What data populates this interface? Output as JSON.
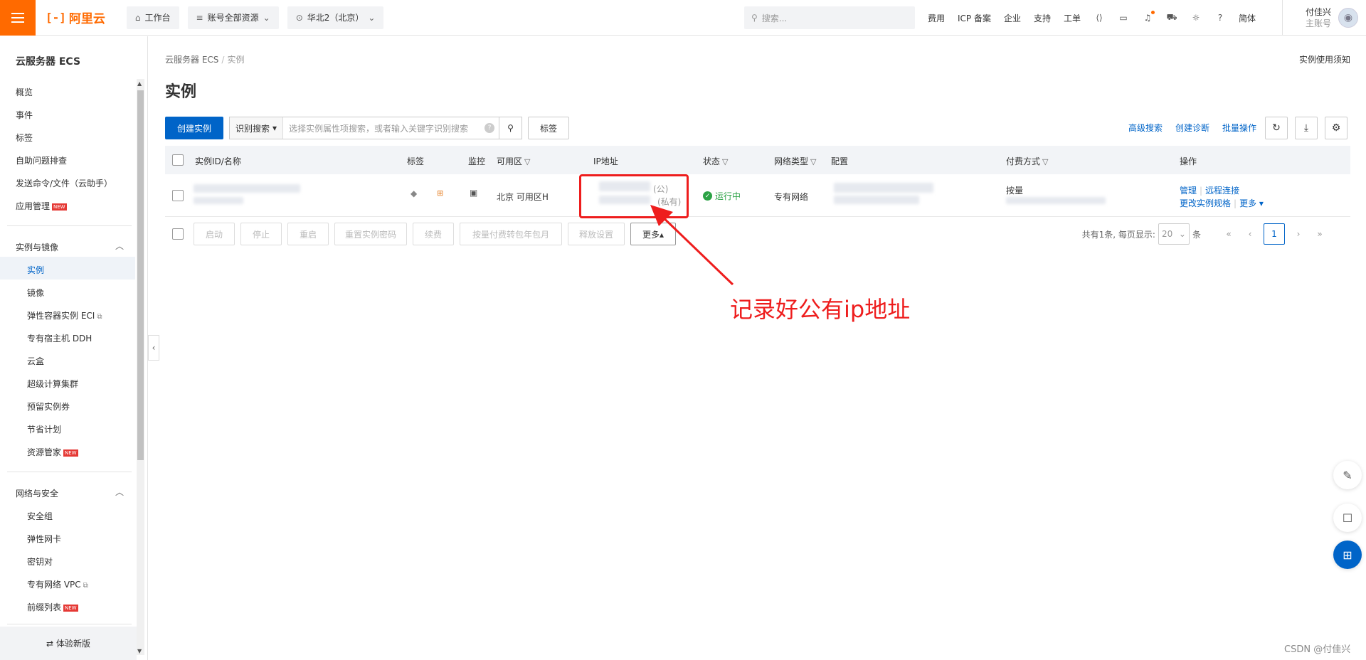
{
  "topbar": {
    "brand": "阿里云",
    "workbench": "工作台",
    "account_resources": "账号全部资源",
    "region": "华北2（北京）",
    "search_placeholder": "搜索...",
    "links": [
      "费用",
      "ICP 备案",
      "企业",
      "支持",
      "工单"
    ],
    "lang": "简体",
    "user_name": "付佳兴",
    "user_role": "主账号"
  },
  "sidebar": {
    "title": "云服务器 ECS",
    "top_items": [
      "概览",
      "事件",
      "标签",
      "自助问题排查",
      "发送命令/文件（云助手）",
      "应用管理"
    ],
    "group1": {
      "label": "实例与镜像",
      "items": [
        "实例",
        "镜像",
        "弹性容器实例 ECI",
        "专有宿主机 DDH",
        "云盒",
        "超级计算集群",
        "预留实例券",
        "节省计划",
        "资源管家"
      ]
    },
    "group2": {
      "label": "网络与安全",
      "items": [
        "安全组",
        "弹性网卡",
        "密钥对",
        "专有网络 VPC",
        "前缀列表"
      ]
    },
    "new_badge": "NEW",
    "footer": "体验新版"
  },
  "main": {
    "breadcrumb_root": "云服务器 ECS",
    "breadcrumb_current": "实例",
    "notice": "实例使用须知",
    "title": "实例",
    "create_button": "创建实例",
    "search_mode": "识别搜索",
    "search_placeholder": "选择实例属性项搜索，或者输入关键字识别搜索",
    "tag_button": "标签",
    "adv_search": "高级搜索",
    "create_diag": "创建诊断",
    "batch_op": "批量操作"
  },
  "table": {
    "headers": {
      "id_name": "实例ID/名称",
      "tags": "标签",
      "monitor": "监控",
      "zone": "可用区",
      "ip": "IP地址",
      "status": "状态",
      "network": "网络类型",
      "config": "配置",
      "billing": "付费方式",
      "ops": "操作"
    },
    "row": {
      "zone": "北京 可用区H",
      "ip_public_suffix": "(公)",
      "ip_private_suffix": "(私有)",
      "status": "运行中",
      "network": "专有网络",
      "billing": "按量",
      "op_manage": "管理",
      "op_remote": "远程连接",
      "op_change": "更改实例规格",
      "op_more": "更多"
    }
  },
  "actions": {
    "buttons": [
      "启动",
      "停止",
      "重启",
      "重置实例密码",
      "续费",
      "按量付费转包年包月",
      "释放设置"
    ],
    "more": "更多▴",
    "total": "共有1条, 每页显示:",
    "page_size": "20",
    "unit": "条",
    "current_page": "1"
  },
  "annotation": "记录好公有ip地址",
  "watermark": "CSDN @付佳兴",
  "colors": {
    "accent": "#ff6a00",
    "primary": "#0064c8",
    "running": "#2ba245",
    "annotation": "#ee1d1d"
  }
}
